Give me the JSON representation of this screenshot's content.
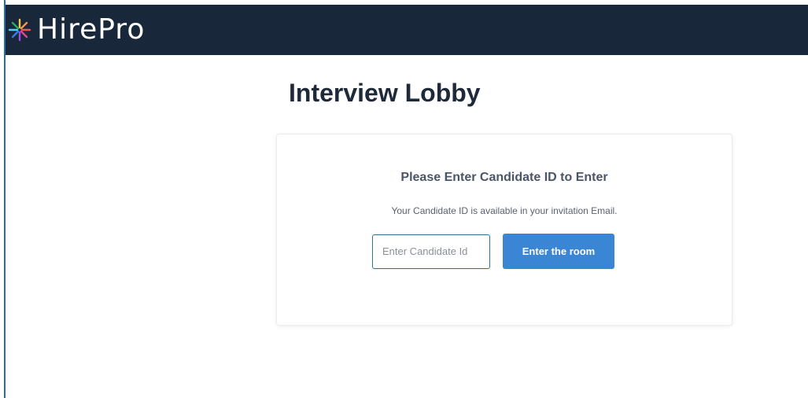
{
  "header": {
    "logo_text": "HirePro",
    "logo_icon": "starburst-logo-icon",
    "background_color": "#18273a"
  },
  "main": {
    "title": "Interview Lobby"
  },
  "card": {
    "heading": "Please Enter Candidate ID to Enter",
    "subtext": "Your Candidate ID is available in your invitation Email.",
    "input": {
      "value": "",
      "placeholder": "Enter Candidate Id"
    },
    "button_label": "Enter the room",
    "button_color": "#3b86d4"
  }
}
